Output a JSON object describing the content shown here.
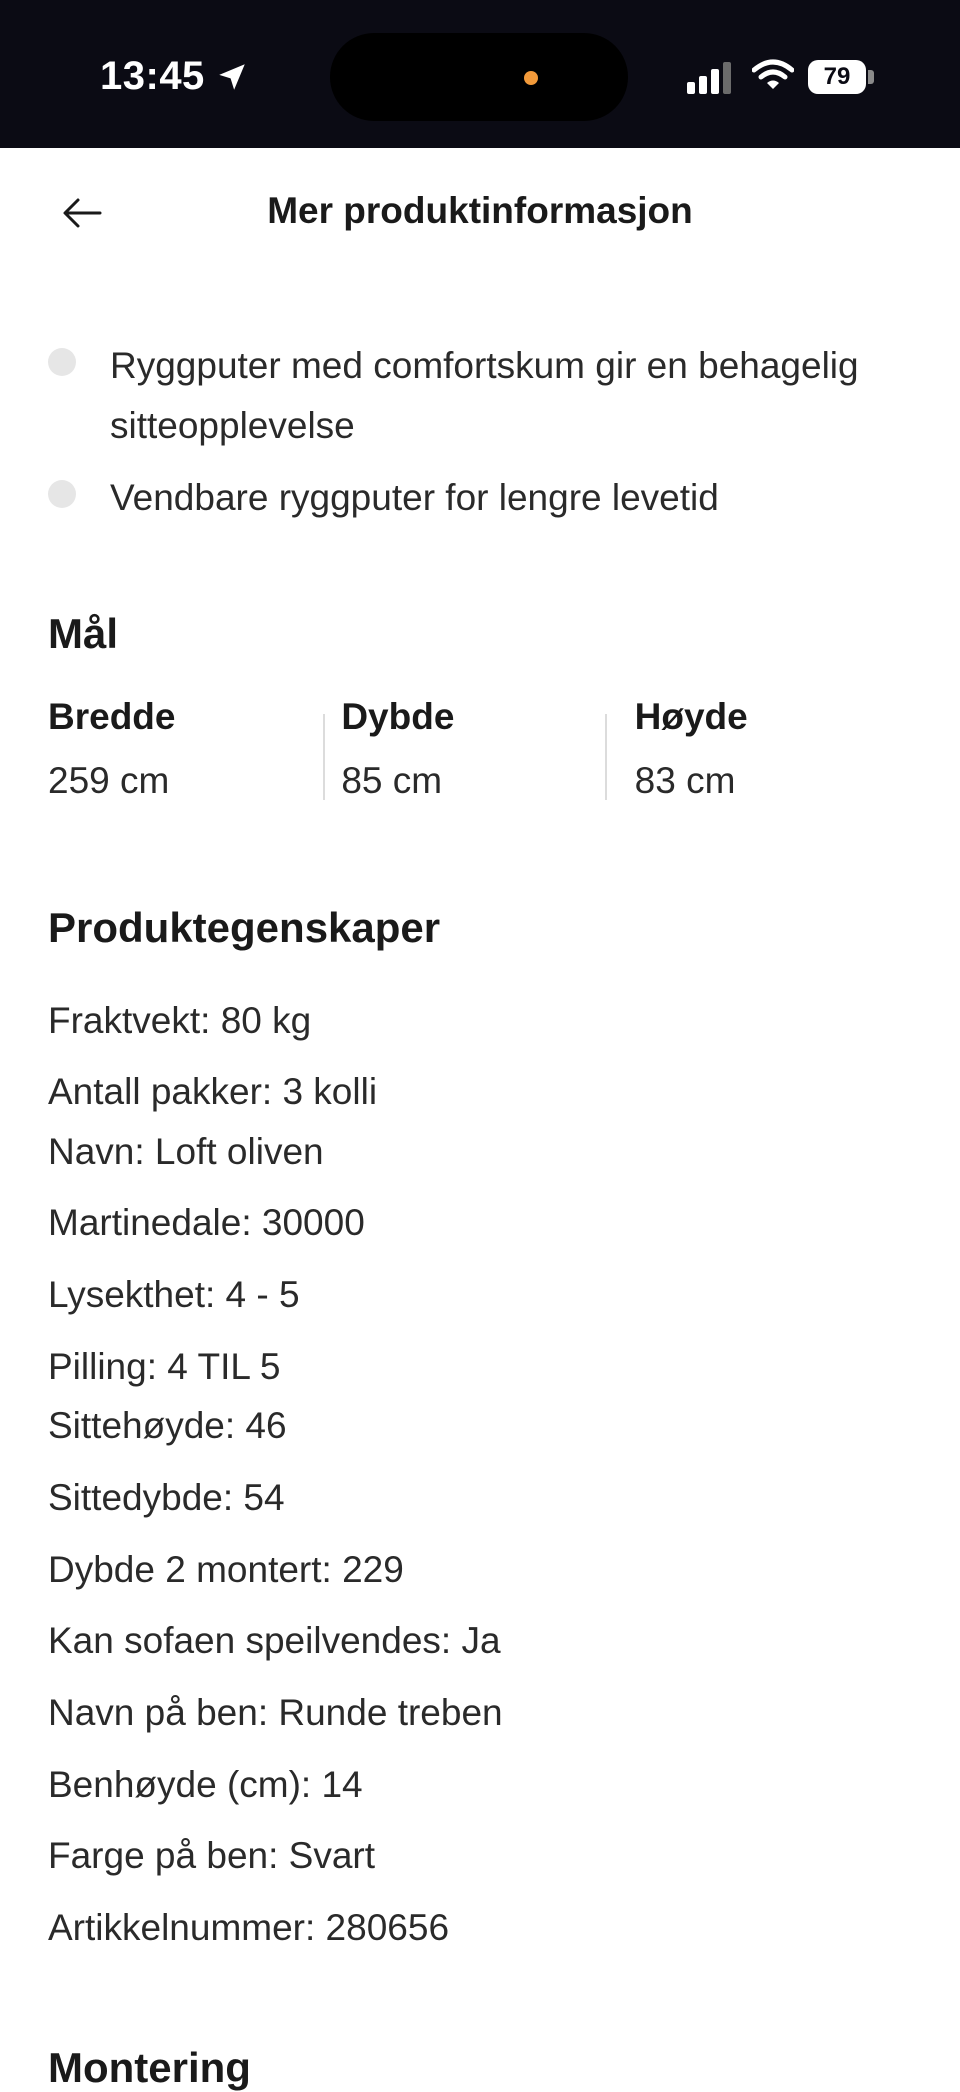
{
  "status_bar": {
    "time": "13:45",
    "battery": "79"
  },
  "header": {
    "title": "Mer produktinformasjon"
  },
  "bullets": [
    "Ryggputer med comfortskum gir en behagelig sitteopplevelse",
    "Vendbare ryggputer for lengre levetid"
  ],
  "dimensions": {
    "heading": "Mål",
    "items": [
      {
        "label": "Bredde",
        "value": "259 cm"
      },
      {
        "label": "Dybde",
        "value": "85 cm"
      },
      {
        "label": "Høyde",
        "value": "83 cm"
      }
    ]
  },
  "properties": {
    "heading": "Produktegenskaper",
    "items": [
      "Fraktvekt: 80 kg",
      "Antall pakker: 3 kolli",
      "Navn: Loft oliven",
      "Martinedale: 30000",
      "Lysekthet: 4 - 5",
      "Pilling: 4 TIL 5",
      "Sittehøyde: 46",
      "Sittedybde: 54",
      "Dybde 2 montert: 229",
      "Kan sofaen speilvendes: Ja",
      "Navn på ben: Runde treben",
      "Benhøyde (cm): 14",
      "Farge på ben: Svart",
      "Artikkelnummer: 280656"
    ]
  },
  "assembly": {
    "heading": "Montering"
  }
}
